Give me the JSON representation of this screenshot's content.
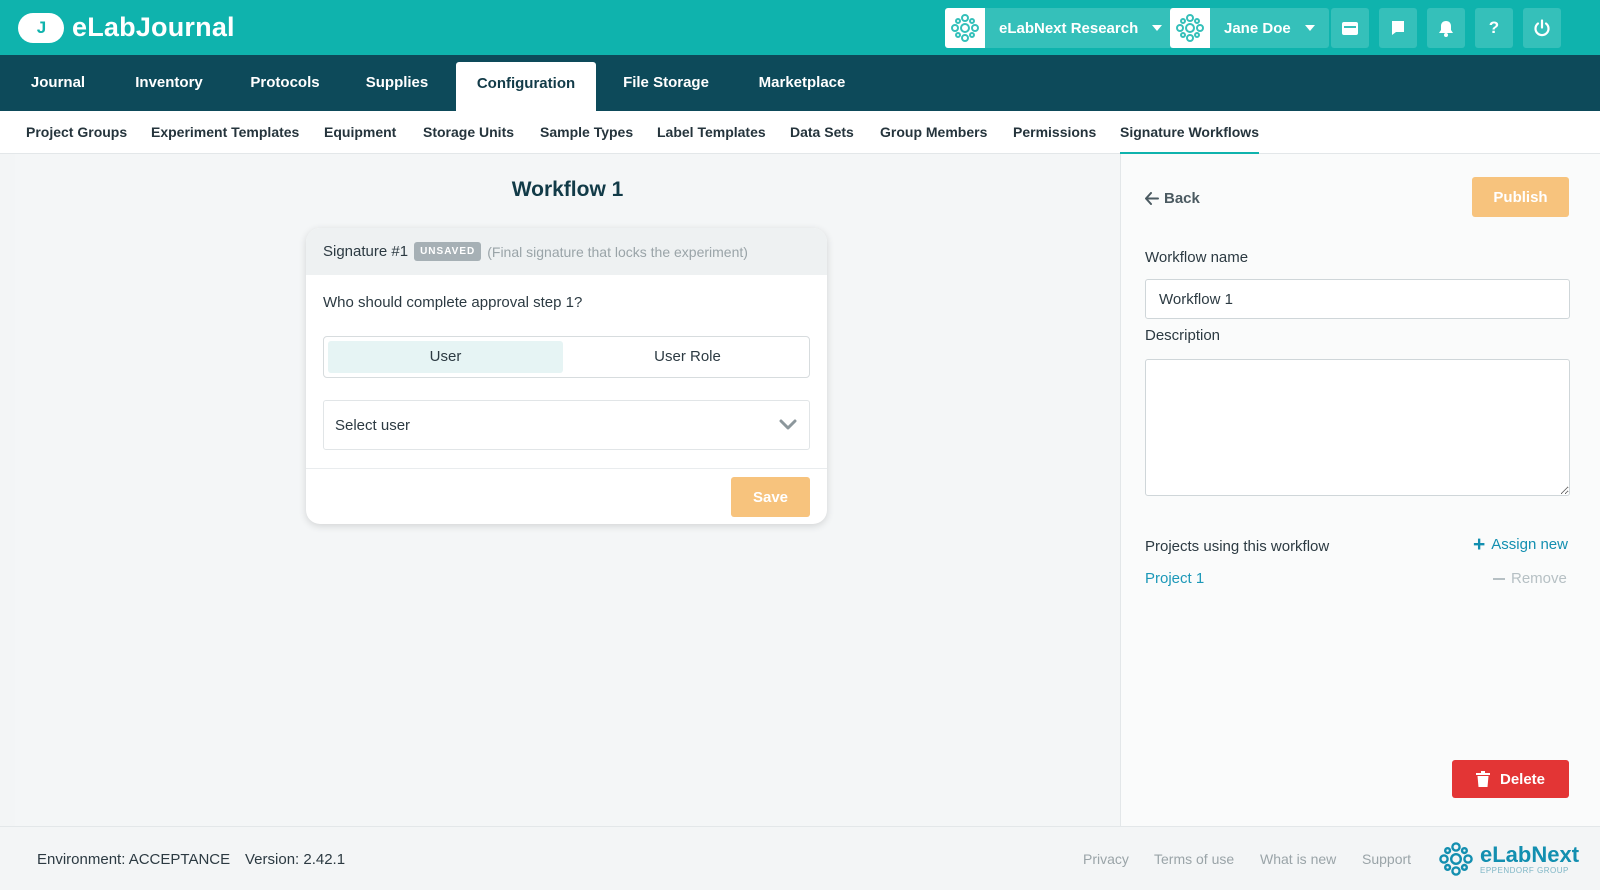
{
  "app": {
    "logo_mark": "J",
    "logo_text": "eLabJournal"
  },
  "header": {
    "org_label": "eLabNext Research",
    "user_label": "Jane Doe",
    "icons": [
      "calendar-icon",
      "chat-icon",
      "bell-icon",
      "help-icon",
      "power-icon"
    ],
    "help_glyph": "?"
  },
  "main_nav": {
    "tabs": [
      {
        "label": "Journal"
      },
      {
        "label": "Inventory"
      },
      {
        "label": "Protocols"
      },
      {
        "label": "Supplies"
      },
      {
        "label": "Configuration",
        "active": true
      },
      {
        "label": "File Storage"
      },
      {
        "label": "Marketplace"
      }
    ]
  },
  "sub_nav": {
    "items": [
      {
        "label": "Project Groups"
      },
      {
        "label": "Experiment Templates"
      },
      {
        "label": "Equipment"
      },
      {
        "label": "Storage Units"
      },
      {
        "label": "Sample Types"
      },
      {
        "label": "Label Templates"
      },
      {
        "label": "Data Sets"
      },
      {
        "label": "Group Members"
      },
      {
        "label": "Permissions"
      },
      {
        "label": "Signature Workflows",
        "active": true
      }
    ]
  },
  "workflow": {
    "title": "Workflow 1",
    "signature": {
      "title": "Signature #1",
      "badge": "UNSAVED",
      "note": "(Final signature that locks the experiment)",
      "question": "Who should complete approval step 1?",
      "options": [
        "User",
        "User Role"
      ],
      "selected_option": "User",
      "select_placeholder": "Select user",
      "save_label": "Save"
    }
  },
  "panel": {
    "back_label": "Back",
    "publish_label": "Publish",
    "name_label": "Workflow name",
    "name_value": "Workflow 1",
    "description_label": "Description",
    "description_value": "",
    "projects_label": "Projects using this workflow",
    "assign_label": "Assign new",
    "projects": [
      {
        "name": "Project 1",
        "remove_label": "Remove"
      }
    ],
    "delete_label": "Delete"
  },
  "footer": {
    "environment": "Environment: ACCEPTANCE",
    "version": "Version: 2.42.1",
    "links": [
      "Privacy",
      "Terms of use",
      "What is new",
      "Support"
    ],
    "brand_name": "eLabNext",
    "brand_sub": "EPPENDORF GROUP"
  },
  "colors": {
    "top_bar": "#0fb3ad",
    "main_nav": "#0d4a5a",
    "accent_orange": "#f7c37d",
    "danger": "#e33535",
    "link": "#138fb0"
  }
}
